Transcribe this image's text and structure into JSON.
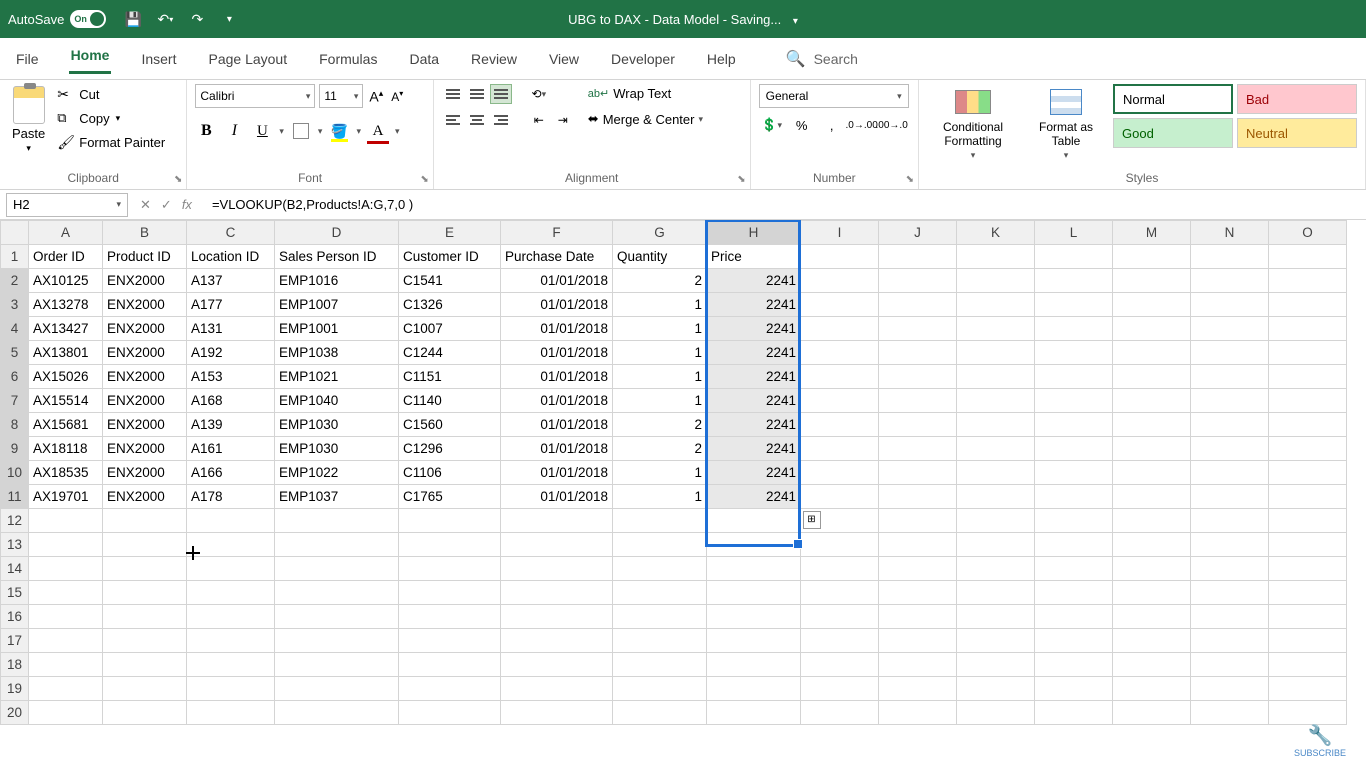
{
  "titleBar": {
    "autoSave": "AutoSave",
    "autoSaveState": "On",
    "docTitle": "UBG to DAX - Data Model - Saving..."
  },
  "tabs": {
    "file": "File",
    "home": "Home",
    "insert": "Insert",
    "pageLayout": "Page Layout",
    "formulas": "Formulas",
    "data": "Data",
    "review": "Review",
    "view": "View",
    "developer": "Developer",
    "help": "Help",
    "search": "Search"
  },
  "ribbon": {
    "clipboard": {
      "label": "Clipboard",
      "paste": "Paste",
      "cut": "Cut",
      "copy": "Copy",
      "formatPainter": "Format Painter"
    },
    "font": {
      "label": "Font",
      "name": "Calibri",
      "size": "11"
    },
    "alignment": {
      "label": "Alignment",
      "wrap": "Wrap Text",
      "merge": "Merge & Center"
    },
    "number": {
      "label": "Number",
      "format": "General"
    },
    "styles": {
      "label": "Styles",
      "cond": "Conditional Formatting",
      "table": "Format as Table",
      "normal": "Normal",
      "bad": "Bad",
      "good": "Good",
      "neutral": "Neutral"
    }
  },
  "formulaBar": {
    "nameBox": "H2",
    "formula": "=VLOOKUP(B2,Products!A:G,7,0 )"
  },
  "sheet": {
    "columns": [
      "A",
      "B",
      "C",
      "D",
      "E",
      "F",
      "G",
      "H",
      "I",
      "J",
      "K",
      "L",
      "M",
      "N",
      "O"
    ],
    "headers": [
      "Order ID",
      "Product ID",
      "Location ID",
      "Sales Person ID",
      "Customer ID",
      "Purchase Date",
      "Quantity",
      "Price"
    ],
    "rows": [
      {
        "a": "AX10125",
        "b": "ENX2000",
        "c": "A137",
        "d": "EMP1016",
        "e": "C1541",
        "f": "01/01/2018",
        "g": "2",
        "h": "2241"
      },
      {
        "a": "AX13278",
        "b": "ENX2000",
        "c": "A177",
        "d": "EMP1007",
        "e": "C1326",
        "f": "01/01/2018",
        "g": "1",
        "h": "2241"
      },
      {
        "a": "AX13427",
        "b": "ENX2000",
        "c": "A131",
        "d": "EMP1001",
        "e": "C1007",
        "f": "01/01/2018",
        "g": "1",
        "h": "2241"
      },
      {
        "a": "AX13801",
        "b": "ENX2000",
        "c": "A192",
        "d": "EMP1038",
        "e": "C1244",
        "f": "01/01/2018",
        "g": "1",
        "h": "2241"
      },
      {
        "a": "AX15026",
        "b": "ENX2000",
        "c": "A153",
        "d": "EMP1021",
        "e": "C1151",
        "f": "01/01/2018",
        "g": "1",
        "h": "2241"
      },
      {
        "a": "AX15514",
        "b": "ENX2000",
        "c": "A168",
        "d": "EMP1040",
        "e": "C1140",
        "f": "01/01/2018",
        "g": "1",
        "h": "2241"
      },
      {
        "a": "AX15681",
        "b": "ENX2000",
        "c": "A139",
        "d": "EMP1030",
        "e": "C1560",
        "f": "01/01/2018",
        "g": "2",
        "h": "2241"
      },
      {
        "a": "AX18118",
        "b": "ENX2000",
        "c": "A161",
        "d": "EMP1030",
        "e": "C1296",
        "f": "01/01/2018",
        "g": "2",
        "h": "2241"
      },
      {
        "a": "AX18535",
        "b": "ENX2000",
        "c": "A166",
        "d": "EMP1022",
        "e": "C1106",
        "f": "01/01/2018",
        "g": "1",
        "h": "2241"
      },
      {
        "a": "AX19701",
        "b": "ENX2000",
        "c": "A178",
        "d": "EMP1037",
        "e": "C1765",
        "f": "01/01/2018",
        "g": "1",
        "h": "2241"
      }
    ],
    "emptyRowCount": 9
  },
  "subscribe": "SUBSCRIBE"
}
